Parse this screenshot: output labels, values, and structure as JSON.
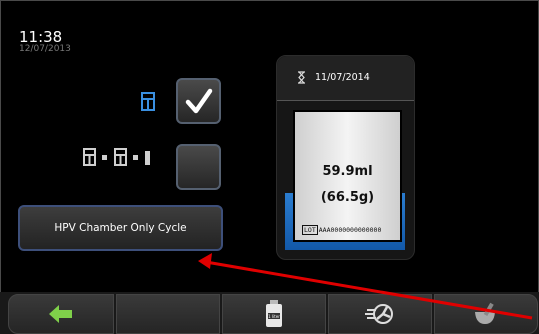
{
  "header": {
    "time": "11:38",
    "date": "12/07/2013"
  },
  "options": {
    "chamber_only_checked": true,
    "full_cycle_checked": false
  },
  "cycle_button_label": "HPV Chamber Only Cycle",
  "cartridge": {
    "expiry_date": "11/07/2014",
    "volume": "59.9ml",
    "weight": "(66.5g)",
    "lot_label": "LOT",
    "lot_number": "AAA0000000000000"
  },
  "toolbar": {
    "items": [
      {
        "icon": "back-arrow-icon"
      },
      {
        "icon": "empty"
      },
      {
        "icon": "bottle-icon",
        "label": "1 liter"
      },
      {
        "icon": "aeration-fan-icon"
      },
      {
        "icon": "mortar-pestle-icon"
      }
    ]
  },
  "colors": {
    "accent_blue": "#3a8fe0",
    "annotation_red": "#e00000",
    "back_green": "#7fd04a"
  }
}
